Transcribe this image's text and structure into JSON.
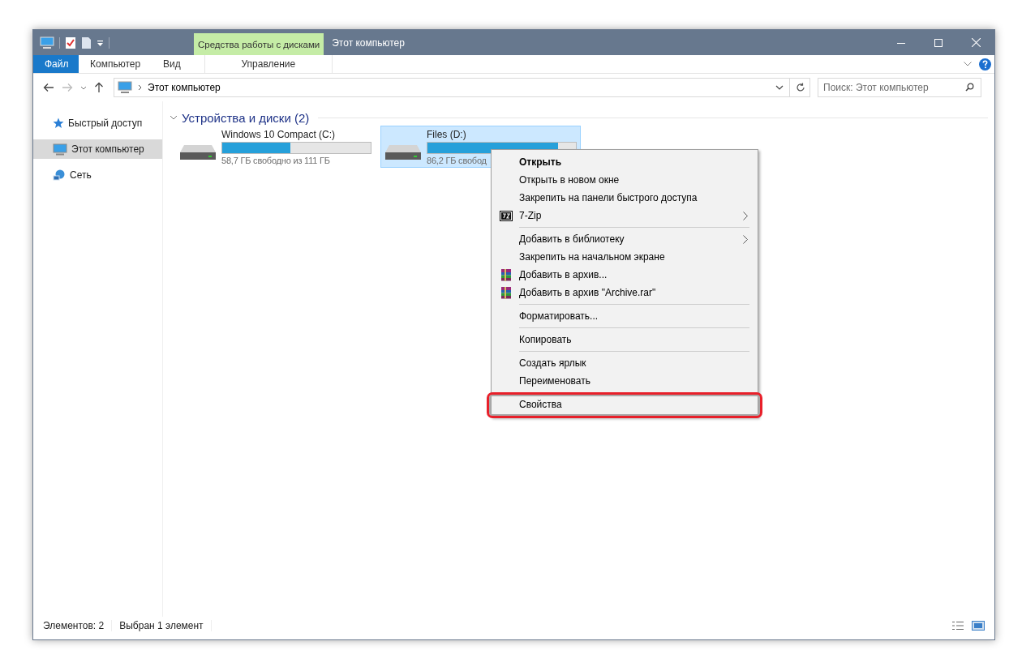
{
  "window": {
    "title": "Этот компьютер",
    "context_tab": "Средства работы с дисками"
  },
  "ribbon_tabs": [
    {
      "label": "Файл",
      "kind": "file"
    },
    {
      "label": "Компьютер",
      "kind": "tab"
    },
    {
      "label": "Вид",
      "kind": "tab"
    },
    {
      "label": "Управление",
      "kind": "context"
    }
  ],
  "address": {
    "path": "Этот компьютер"
  },
  "search": {
    "placeholder": "Поиск: Этот компьютер"
  },
  "sidebar": {
    "items": [
      {
        "label": "Быстрый доступ",
        "kind": "star",
        "selected": false
      },
      {
        "label": "Этот компьютер",
        "kind": "pc",
        "selected": true
      },
      {
        "label": "Сеть",
        "kind": "network",
        "selected": false
      }
    ]
  },
  "group": {
    "title": "Устройства и диски (2)",
    "expanded": true
  },
  "drives": [
    {
      "name": "Windows 10 Compact (C:)",
      "free": "58,7 ГБ свободно из 111 ГБ",
      "level": 0.46,
      "selected": false
    },
    {
      "name": "Files (D:)",
      "free": "86,2 ГБ свобод",
      "level": 0.88,
      "selected": true
    }
  ],
  "context_menu": {
    "items": [
      {
        "kind": "item",
        "label": "Открыть",
        "bold": true,
        "submenu": false,
        "highlighted": false
      },
      {
        "kind": "item",
        "label": "Открыть в новом окне",
        "bold": false,
        "submenu": false,
        "highlighted": false
      },
      {
        "kind": "item",
        "label": "Закрепить на панели быстрого доступа",
        "bold": false,
        "submenu": false,
        "highlighted": false
      },
      {
        "kind": "sevenzip",
        "label": "7-Zip",
        "bold": false,
        "submenu": true,
        "highlighted": false
      },
      {
        "kind": "separator"
      },
      {
        "kind": "item",
        "label": "Добавить в библиотеку",
        "bold": false,
        "submenu": true,
        "highlighted": false
      },
      {
        "kind": "item",
        "label": "Закрепить на начальном экране",
        "bold": false,
        "submenu": false,
        "highlighted": false
      },
      {
        "kind": "archiver",
        "label": "Добавить в архив...",
        "bold": false,
        "submenu": false,
        "highlighted": false
      },
      {
        "kind": "archiver",
        "label": "Добавить в архив \"Archive.rar\"",
        "bold": false,
        "submenu": false,
        "highlighted": false
      },
      {
        "kind": "separator"
      },
      {
        "kind": "item",
        "label": "Форматировать...",
        "bold": false,
        "submenu": false,
        "highlighted": false
      },
      {
        "kind": "separator"
      },
      {
        "kind": "item",
        "label": "Копировать",
        "bold": false,
        "submenu": false,
        "highlighted": false
      },
      {
        "kind": "separator"
      },
      {
        "kind": "item",
        "label": "Создать ярлык",
        "bold": false,
        "submenu": false,
        "highlighted": false
      },
      {
        "kind": "item",
        "label": "Переименовать",
        "bold": false,
        "submenu": false,
        "highlighted": false
      },
      {
        "kind": "separator"
      },
      {
        "kind": "item",
        "label": "Свойства",
        "bold": false,
        "submenu": false,
        "highlighted": true
      }
    ]
  },
  "status_bar": {
    "count": "Элементов: 2",
    "selection": "Выбран 1 элемент"
  }
}
